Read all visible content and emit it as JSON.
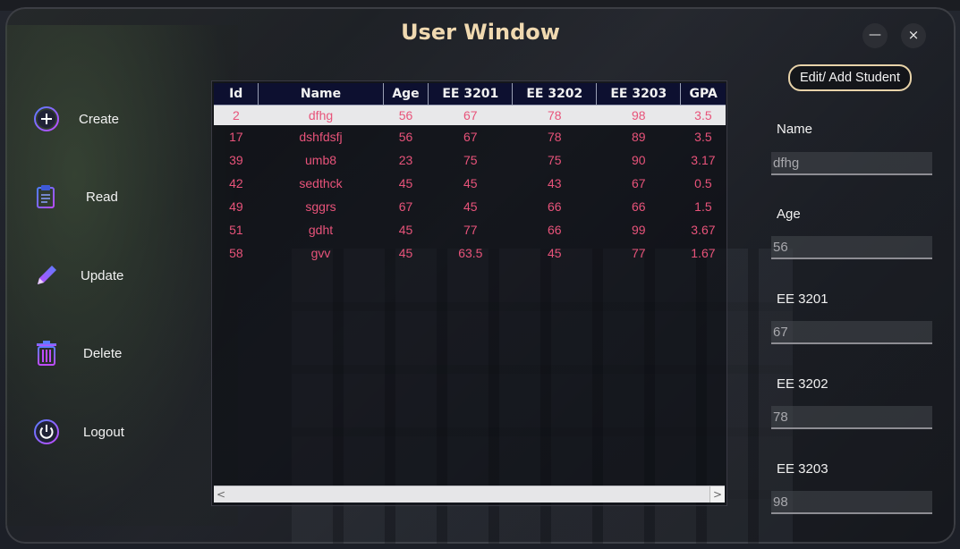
{
  "window": {
    "title": "User Window",
    "min_label": "—",
    "close_label": "×"
  },
  "sidebar": {
    "items": [
      {
        "label": "Create",
        "icon": "plus-circle-icon"
      },
      {
        "label": "Read",
        "icon": "clipboard-icon"
      },
      {
        "label": "Update",
        "icon": "pencil-icon"
      },
      {
        "label": "Delete",
        "icon": "trash-icon"
      },
      {
        "label": "Logout",
        "icon": "power-icon"
      }
    ]
  },
  "table": {
    "columns": [
      "Id",
      "Name",
      "Age",
      "EE 3201",
      "EE 3202",
      "EE 3203",
      "GPA"
    ],
    "rows": [
      [
        "2",
        "dfhg",
        "56",
        "67",
        "78",
        "98",
        "3.5"
      ],
      [
        "17",
        "dshfdsfj",
        "56",
        "67",
        "78",
        "89",
        "3.5"
      ],
      [
        "39",
        "umb8",
        "23",
        "75",
        "75",
        "90",
        "3.17"
      ],
      [
        "42",
        "sedthck",
        "45",
        "45",
        "43",
        "67",
        "0.5"
      ],
      [
        "49",
        "sggrs",
        "67",
        "45",
        "66",
        "66",
        "1.5"
      ],
      [
        "51",
        "gdht",
        "45",
        "77",
        "66",
        "99",
        "3.67"
      ],
      [
        "58",
        "gvv",
        "45",
        "63.5",
        "45",
        "77",
        "1.67"
      ]
    ],
    "selected_index": 0,
    "scroll_left": "<",
    "scroll_right": ">"
  },
  "form": {
    "edit_button": "Edit/ Add Student",
    "fields": [
      {
        "label": "Name",
        "value": "dfhg"
      },
      {
        "label": "Age",
        "value": "56"
      },
      {
        "label": "EE 3201",
        "value": "67"
      },
      {
        "label": "EE 3202",
        "value": "78"
      },
      {
        "label": "EE 3203",
        "value": "98"
      }
    ]
  },
  "colors": {
    "title": "#f0d9b0",
    "cell_text": "#e8537a",
    "header_bg": "#0d1030",
    "accent_border": "#e8d3a9"
  }
}
